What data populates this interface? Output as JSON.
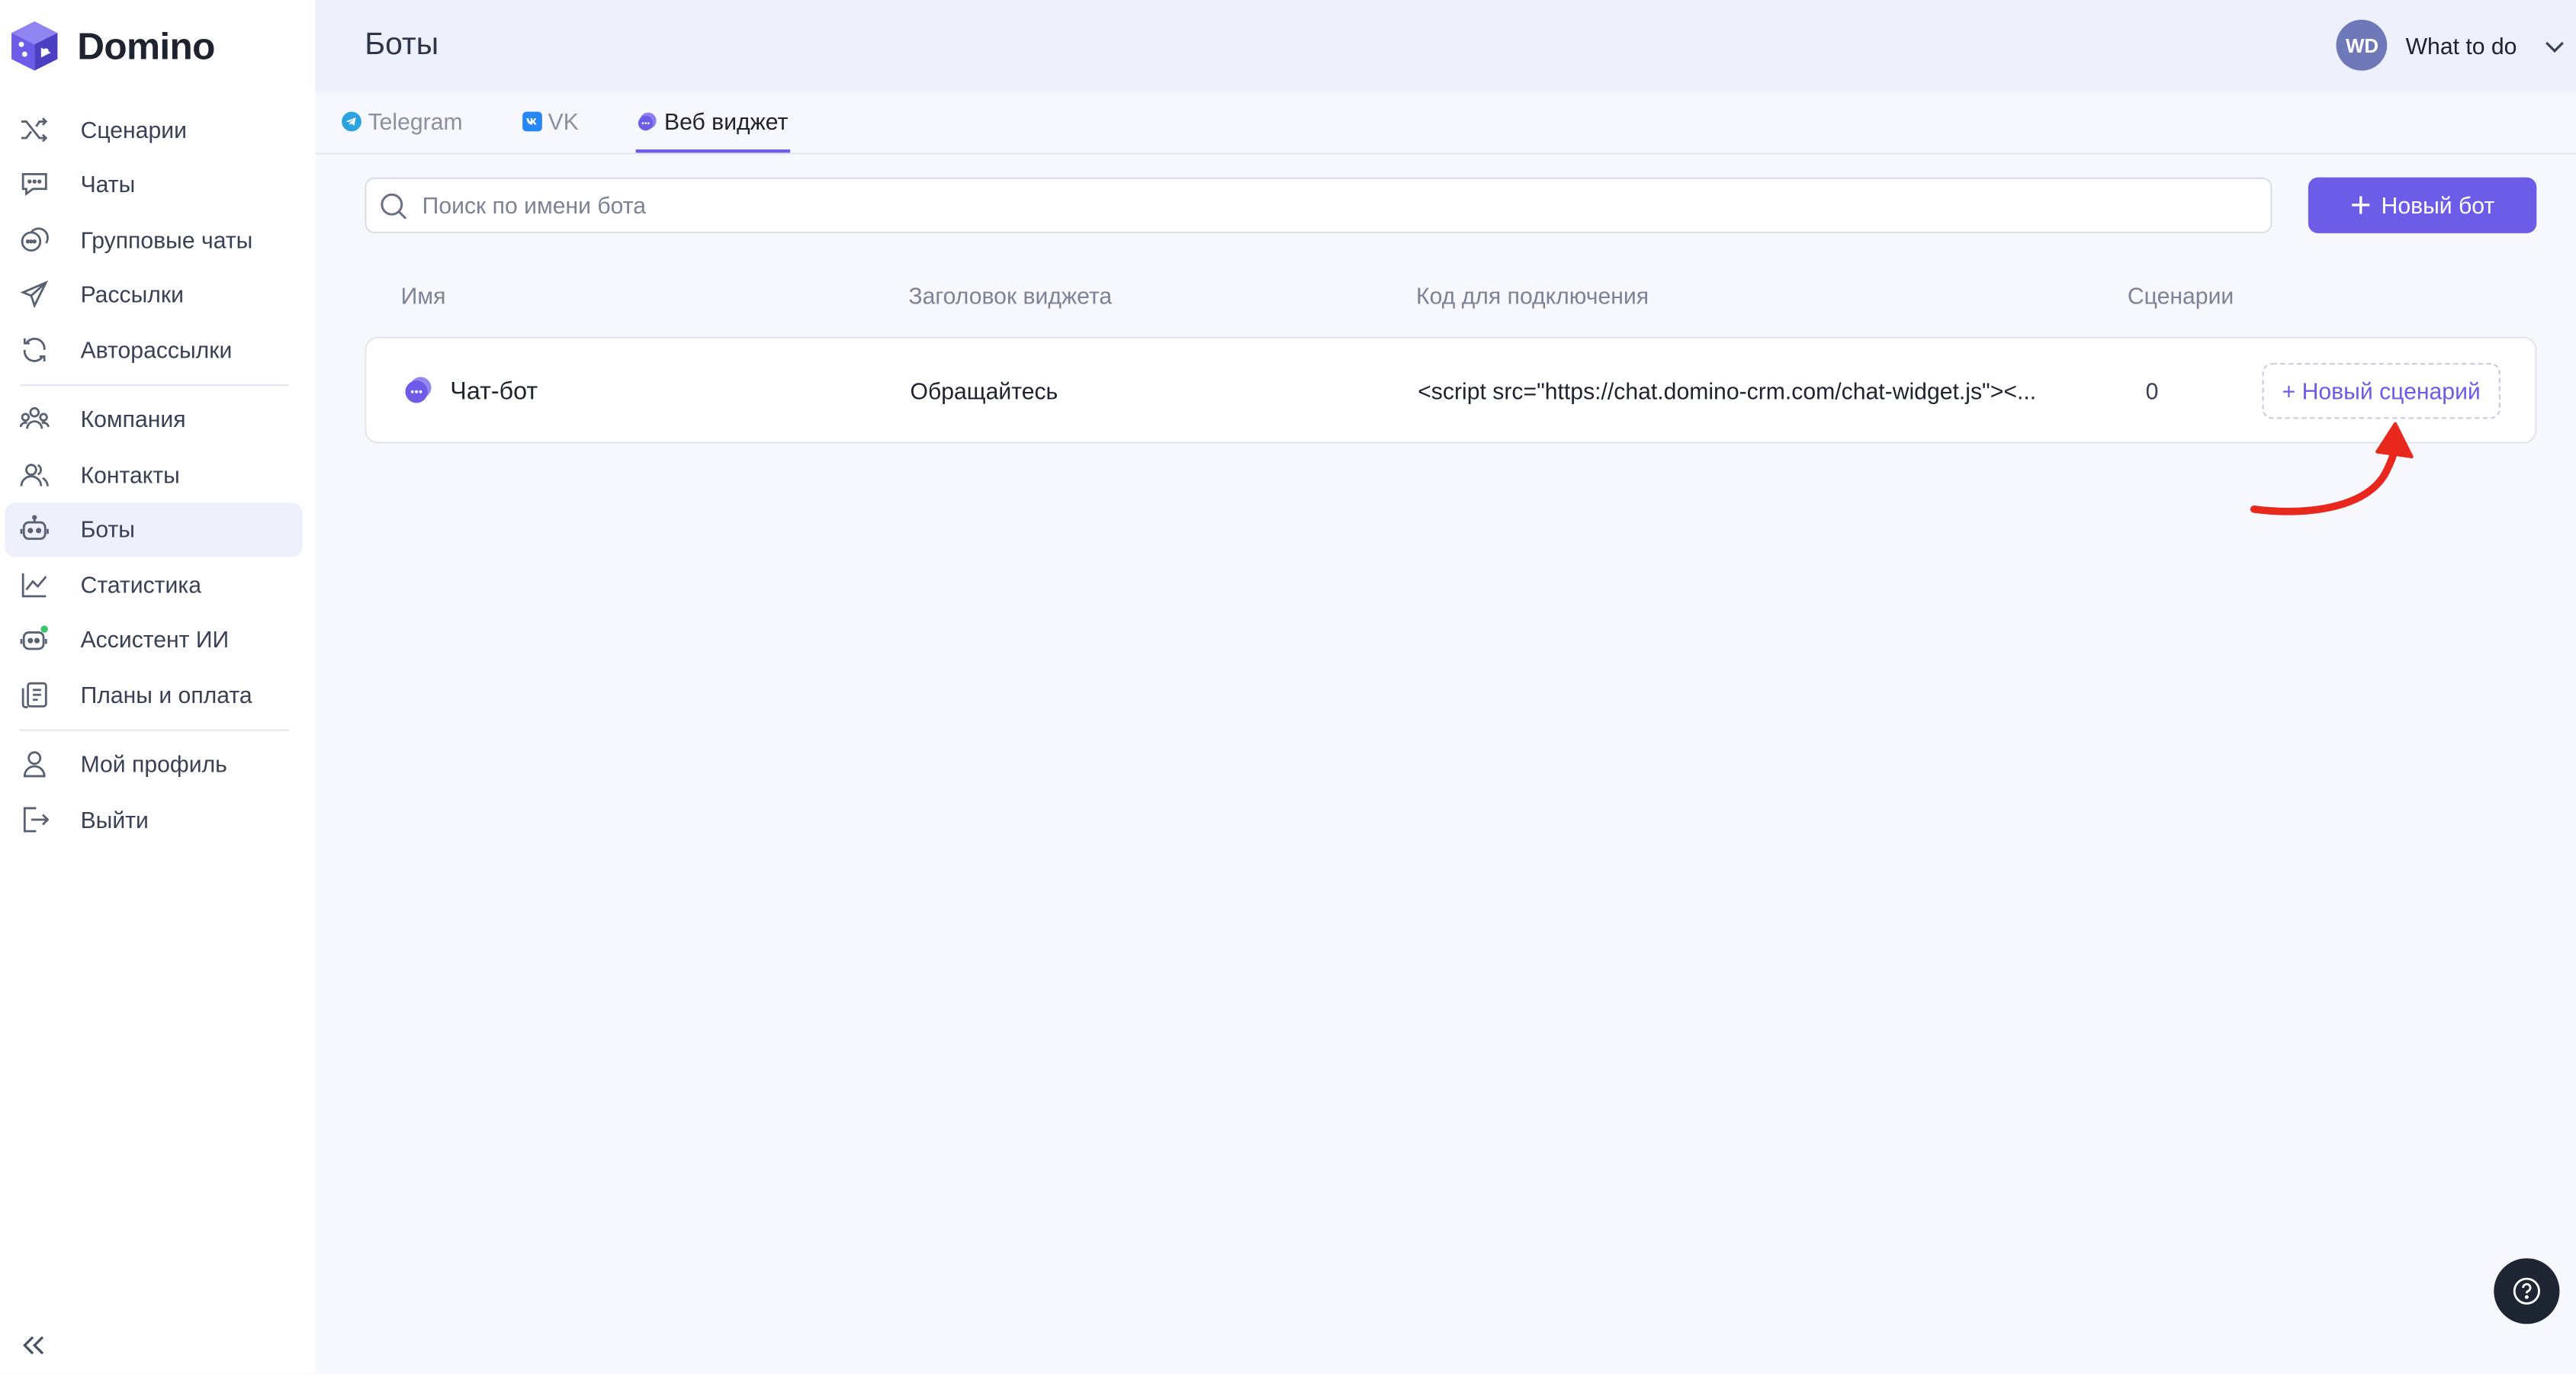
{
  "app": {
    "name": "Domino"
  },
  "sidebar": {
    "items": [
      {
        "label": "Сценарии",
        "icon": "shuffle-icon"
      },
      {
        "label": "Чаты",
        "icon": "chat-icon"
      },
      {
        "label": "Групповые чаты",
        "icon": "group-chat-icon"
      },
      {
        "label": "Рассылки",
        "icon": "send-icon"
      },
      {
        "label": "Авторассылки",
        "icon": "auto-send-icon"
      },
      {
        "label": "Компания",
        "icon": "company-icon"
      },
      {
        "label": "Контакты",
        "icon": "contacts-icon"
      },
      {
        "label": "Боты",
        "icon": "bot-icon",
        "active": true
      },
      {
        "label": "Статистика",
        "icon": "chart-icon"
      },
      {
        "label": "Ассистент ИИ",
        "icon": "ai-assistant-icon"
      },
      {
        "label": "Планы и оплата",
        "icon": "billing-icon"
      },
      {
        "label": "Мой профиль",
        "icon": "profile-icon"
      },
      {
        "label": "Выйти",
        "icon": "logout-icon"
      }
    ]
  },
  "header": {
    "title": "Боты",
    "user": {
      "initials": "WD",
      "name": "What to do"
    }
  },
  "tabs": [
    {
      "label": "Telegram",
      "active": false
    },
    {
      "label": "VK",
      "active": false
    },
    {
      "label": "Веб виджет",
      "active": true
    }
  ],
  "search": {
    "placeholder": "Поиск по имени бота",
    "value": ""
  },
  "toolbar": {
    "new_bot_label": "Новый бот",
    "new_bot_plus": "+"
  },
  "table": {
    "columns": [
      "Имя",
      "Заголовок виджета",
      "Код для подключения",
      "Сценарии"
    ],
    "rows": [
      {
        "name": "Чат-бот",
        "widget_title": "Обращайтесь",
        "code": "<script src=\"https://chat.domino-crm.com/chat-widget.js\"><...",
        "scenarios": "0",
        "action": "+ Новый сценарий"
      }
    ]
  },
  "colors": {
    "accent": "#6c5ce7",
    "annotation_arrow": "#e8281c",
    "sidebar_active": "#eef0fb"
  },
  "help": {
    "label": "?"
  }
}
